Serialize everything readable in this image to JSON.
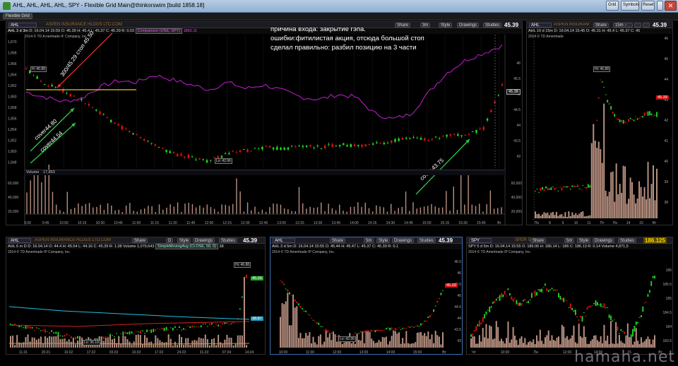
{
  "window": {
    "title": "AHL, AHL, AHL, AHL, SPY - Flexible Grid Main@thinkorswim [build 1858.18]",
    "buttons": [
      "Grid",
      "Symbols",
      "Reset"
    ]
  },
  "toolbar": {
    "tab_label": "Flexible Grid"
  },
  "common": {
    "share": "Share",
    "style": "Style",
    "drawings": "Drawings",
    "studies": "Studies",
    "company": "ASPEN INSURANCE HLDGS LTD.COM"
  },
  "main": {
    "symbol": "AHL",
    "timeframe": "3m",
    "price": "45.39",
    "info": {
      "agg": "AHL 3 d 3m",
      "D": "D: 16.04.14 15:59",
      "O": "O: 45.39",
      "H": "H: 45.4",
      "L": "L: 45.37",
      "C": "C: 45.39",
      "R": "R: 0.03",
      "cmp": "Comparison (UNE, SPY)",
      "cmp_val": "1862.11"
    },
    "broker": "2014 © TD Ameritrade IP Company, Inc.",
    "notes": [
      "причина входа: закрытие гэпа.",
      "ошибки:фитилистая акция, отсюда большой стоп",
      "сделал правильно: разбил позицию на 3 части"
    ],
    "arrow_labels": [
      "300/45.29 стоп 45.50",
      "cover44.80",
      "cover44.54",
      "cover 43.75"
    ],
    "high_label": "H: 45.88",
    "low_label": "Lo: 42.96",
    "last_box": "45.38",
    "volume_label": "Volume",
    "volume_val": "17,853",
    "y_left": [
      "1,870",
      "1,868",
      "1,866",
      "1,864",
      "1,862",
      "1,860",
      "1,858",
      "1,856",
      "1,854",
      "1,852",
      "1,850",
      "1,848"
    ],
    "y_right": [
      "46",
      "45.5",
      "45",
      "44.5",
      "44",
      "43.5",
      "43"
    ],
    "vol_y": [
      "60,000",
      "40,000",
      "20,000"
    ],
    "x_ticks": [
      "9:30",
      "9:45",
      "10:00",
      "10:15",
      "10:30",
      "10:45",
      "11:00",
      "11:15",
      "11:30",
      "11:45",
      "12:00",
      "12:15",
      "12:30",
      "12:45",
      "13:00",
      "13:15",
      "13:30",
      "13:45",
      "14:00",
      "14:15",
      "14:30",
      "14:45",
      "15:00",
      "15:15",
      "15:30",
      "15:45",
      "Вт"
    ],
    "chart_data": {
      "type": "line",
      "series": [
        {
          "name": "AHL",
          "values": [
            45.88,
            45.45,
            45.2,
            44.9,
            44.5,
            44.1,
            43.8,
            43.5,
            43.2,
            43.1,
            42.96,
            43.2,
            43.3,
            43.4,
            43.35,
            43.45,
            43.4,
            43.5,
            43.45,
            43.5,
            43.6,
            43.7,
            43.65,
            43.75,
            43.8,
            44.0,
            45.39
          ]
        },
        {
          "name": "SPY",
          "values": [
            1862.5,
            1861.5,
            1860.6,
            1861.2,
            1863.5,
            1864.8,
            1864.5,
            1866.0,
            1865.0,
            1864.0,
            1863.0,
            1864.5,
            1863.2,
            1864.0,
            1862.8,
            1861.5,
            1861.0,
            1862.0,
            1861.5,
            1858.2,
            1857.0,
            1858.0,
            1862.5,
            1866.5,
            1869.0,
            1870.5,
            1872.0
          ]
        }
      ]
    }
  },
  "panel_tr": {
    "symbol": "AHL",
    "timeframe": "15m",
    "price": "45.39",
    "info": "AHL 10 d 15m  D: 16.04.14 15:45  O: 45.31  H: 45.4  L: 45.37  C: 45",
    "broker": "2014 © TD Ameritrade",
    "high_label": "Hi: 46.88",
    "last_box": "45.39",
    "y_axis": [
      "46",
      "45",
      "44",
      "43",
      "42",
      "41",
      "40",
      "39",
      "38"
    ],
    "x_ticks": [
      "Пн",
      "8",
      "9",
      "10",
      "11",
      "Пт",
      "Пн",
      "14",
      "15",
      "Вт"
    ],
    "chart_data": {
      "type": "bar",
      "values": [
        39.6,
        39.7,
        39.8,
        39.7,
        39.8,
        39.9,
        39.8,
        40.0,
        46.88,
        45.3,
        44.1,
        44.0,
        44.2,
        44.4,
        44.6,
        44.5
      ]
    }
  },
  "panel_bl": {
    "symbol": "AHL",
    "timeframe": "D",
    "price": "45.39",
    "info": "AHL 6 m D  D: 16.04.14  O: 44.4  H: 45.54  L: 44.16  C: 45.39  R: 1.38  Volume 1,079,643",
    "study": "SimpleMovingAvg (CLOSE, 50, 0)",
    "study2": "38",
    "broker": "2014 © TD Ameritrade IP Company, Inc.",
    "high_label": "Hi: 46.88",
    "low_label": "Lo: 36.18",
    "last_box": "45.39",
    "sma_box": "38.87",
    "x_ticks": [
      "11.01",
      "20.01",
      "10.02",
      "17.02",
      "03.03",
      "10.03",
      "17.03",
      "24.03",
      "31.03",
      "07.04",
      "14.04"
    ],
    "chart_data": {
      "type": "bar",
      "values": [
        38.5,
        38.3,
        38.0,
        37.8,
        37.5,
        37.2,
        36.9,
        36.6,
        36.4,
        36.18,
        36.7,
        37.0,
        37.2,
        37.4,
        37.5,
        37.6,
        37.8,
        37.9,
        38.0,
        38.1,
        38.3,
        38.4,
        38.5,
        38.6,
        38.8,
        45.39
      ]
    }
  },
  "panel_bm": {
    "symbol": "AHL",
    "timeframe": "5m",
    "price": "45.39",
    "info": "AHL 3 d 5m  D: 16.04.14 15:55  O: 45.44  H: 45.47  L: 45.37  C: 45.39  R: 0.1",
    "broker": "2014 © TD Ameritrade IP Company, Inc.",
    "low_label": "Lo: 42.96",
    "last_box": "45.39",
    "x_ticks": [
      "10:00",
      "11:00",
      "12:00",
      "13:00",
      "14:00",
      "15:00",
      "Вт"
    ],
    "y_axis": [
      "46.5",
      "46",
      "45.5",
      "45",
      "44.5",
      "44",
      "43.5",
      "43"
    ],
    "chart_data": {
      "type": "line",
      "values": [
        45.88,
        45.1,
        44.5,
        44.0,
        43.5,
        43.2,
        42.96,
        43.3,
        43.4,
        43.4,
        43.5,
        43.5,
        43.6,
        43.7,
        44.2,
        45.39
      ]
    }
  },
  "panel_br": {
    "symbol": "SPY",
    "timeframe": "5m",
    "price": "186.125",
    "company": "SPDR S",
    "info": "SPY 5 d 5m  D: 16.04.14 15:55  O: 186.06  H: 186.14  L: 186  C: 186.13  R: 0.14  Volume 4,871,5",
    "broker": "2014 © TD Ameritrade IP Company, Inc.",
    "y_axis": [
      "186",
      "185.5",
      "185",
      "184.5",
      "184",
      "183.5"
    ],
    "x_ticks": [
      "Чт",
      "10:00",
      "Пн",
      "12:00",
      "14:00",
      "15",
      "Вт"
    ],
    "chart_data": {
      "type": "line",
      "values": [
        183.4,
        184.0,
        184.8,
        185.2,
        184.6,
        185.0,
        185.4,
        185.2,
        184.6,
        184.0,
        184.8,
        184.5,
        183.6,
        183.2,
        184.4,
        185.9
      ]
    }
  },
  "watermark": "hamaha.net"
}
